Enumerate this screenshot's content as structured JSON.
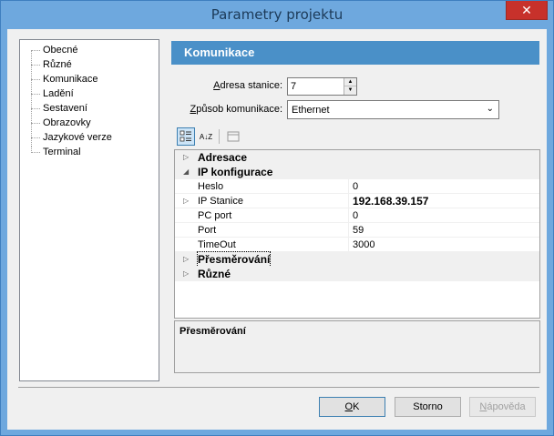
{
  "window": {
    "title": "Parametry projektu",
    "close_glyph": "✕"
  },
  "tree": {
    "items": [
      {
        "label": "Obecné"
      },
      {
        "label": "Různé"
      },
      {
        "label": "Komunikace"
      },
      {
        "label": "Ladění"
      },
      {
        "label": "Sestavení"
      },
      {
        "label": "Obrazovky"
      },
      {
        "label": "Jazykové verze"
      },
      {
        "label": "Terminal"
      }
    ]
  },
  "section": {
    "title": "Komunikace"
  },
  "form": {
    "address_label_pre": "",
    "address_label_u": "A",
    "address_label_post": "dresa stanice:",
    "address_value": "7",
    "method_label_u": "Z",
    "method_label_post": "působ komunikace:",
    "method_value": "Ethernet"
  },
  "toolbar": {
    "categorized_icon": "categorized-icon",
    "alphabetical_icon": "sort-alpha-icon",
    "alpha_glyph": "A↓Z",
    "pages_icon": "property-pages-icon"
  },
  "grid": {
    "rows": [
      {
        "name": "Adresace",
        "value": "",
        "type": "category",
        "expander": "▷"
      },
      {
        "name": "IP konfigurace",
        "value": "",
        "type": "category",
        "expander": "◢"
      },
      {
        "name": "Heslo",
        "value": "0",
        "type": "prop",
        "expander": ""
      },
      {
        "name": "IP Stanice",
        "value": "192.168.39.157",
        "type": "prop",
        "expander": "▷"
      },
      {
        "name": "PC port",
        "value": "0",
        "type": "prop",
        "expander": ""
      },
      {
        "name": "Port",
        "value": "59",
        "type": "prop",
        "expander": ""
      },
      {
        "name": "TimeOut",
        "value": "3000",
        "type": "prop",
        "expander": ""
      },
      {
        "name": "Přesměrování",
        "value": "",
        "type": "category",
        "expander": "▷"
      },
      {
        "name": "Různé",
        "value": "",
        "type": "category",
        "expander": "▷"
      }
    ]
  },
  "description": {
    "title": "Přesměrování"
  },
  "buttons": {
    "ok_u": "O",
    "ok_post": "K",
    "cancel": "Storno",
    "help_u": "N",
    "help_post": "ápověda"
  },
  "colors": {
    "accent": "#4a90c8",
    "titlebar": "#6ea8de",
    "close": "#c7312b"
  }
}
